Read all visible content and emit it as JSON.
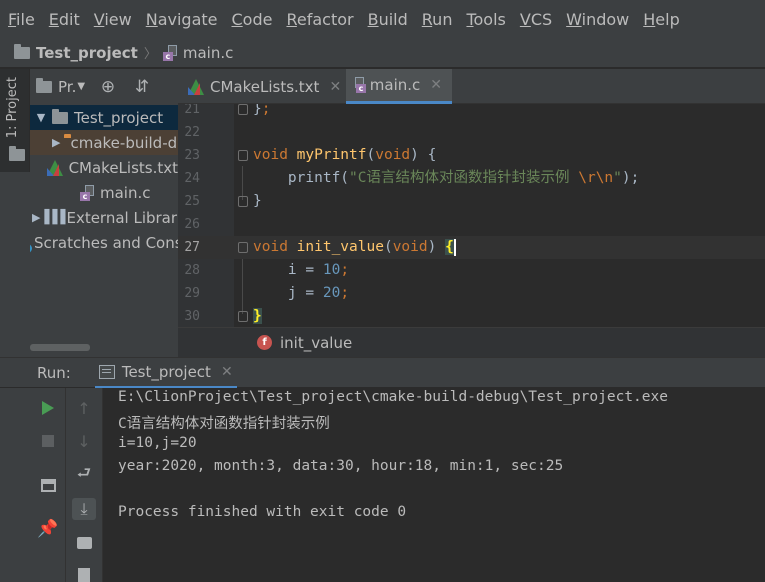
{
  "menu": [
    "File",
    "Edit",
    "View",
    "Navigate",
    "Code",
    "Refactor",
    "Build",
    "Run",
    "Tools",
    "VCS",
    "Window",
    "Help"
  ],
  "nav": {
    "project": "Test_project",
    "file": "main.c"
  },
  "left_strip": {
    "project_tab": "1: Project"
  },
  "project_panel": {
    "view_selector": "Pr.",
    "tree": [
      {
        "label": "Test_project",
        "icon": "folder-icon"
      },
      {
        "label": "cmake-build-debug",
        "icon": "folder-orange-icon"
      },
      {
        "label": "CMakeLists.txt",
        "icon": "cmake-icon"
      },
      {
        "label": "main.c",
        "icon": "c-file-icon"
      },
      {
        "label": "External Libraries",
        "icon": "libraries-icon"
      },
      {
        "label": "Scratches and Consoles",
        "icon": "scratches-icon"
      }
    ]
  },
  "tabs": [
    {
      "label": "CMakeLists.txt",
      "active": false
    },
    {
      "label": "main.c",
      "active": true
    }
  ],
  "editor": {
    "line_numbers": [
      "21",
      "22",
      "23",
      "24",
      "25",
      "26",
      "27",
      "28",
      "29",
      "30"
    ],
    "lines": [
      {
        "parts": [
          "}",
          ";"
        ]
      },
      {
        "parts": []
      },
      {
        "parts": [
          "void",
          " ",
          "myPrintf",
          "(",
          "void",
          ") {"
        ]
      },
      {
        "parts": [
          "    printf(",
          "\"C语言结构体对函数指针封装示例 ",
          "\\r\\n",
          "\"",
          ");"
        ]
      },
      {
        "parts": [
          "}"
        ]
      },
      {
        "parts": []
      },
      {
        "parts": [
          "void",
          " ",
          "init_value",
          "(",
          "void",
          ") ",
          "{"
        ]
      },
      {
        "parts": [
          "    i = ",
          "10",
          ";"
        ]
      },
      {
        "parts": [
          "    j = ",
          "20",
          ";"
        ]
      },
      {
        "parts": [
          "}"
        ]
      }
    ],
    "breadcrumb": "init_value"
  },
  "run": {
    "label": "Run:",
    "tab": "Test_project",
    "output": [
      "E:\\ClionProject\\Test_project\\cmake-build-debug\\Test_project.exe",
      "C语言结构体对函数指针封装示例",
      "i=10,j=20",
      "year:2020, month:3, data:30, hour:18, min:1, sec:25",
      "",
      "Process finished with exit code 0"
    ]
  },
  "colors": {
    "keyword": "#cc7832",
    "function": "#ffc66d",
    "string": "#6a8759",
    "number": "#6897bb",
    "accent": "#4a88c7"
  }
}
